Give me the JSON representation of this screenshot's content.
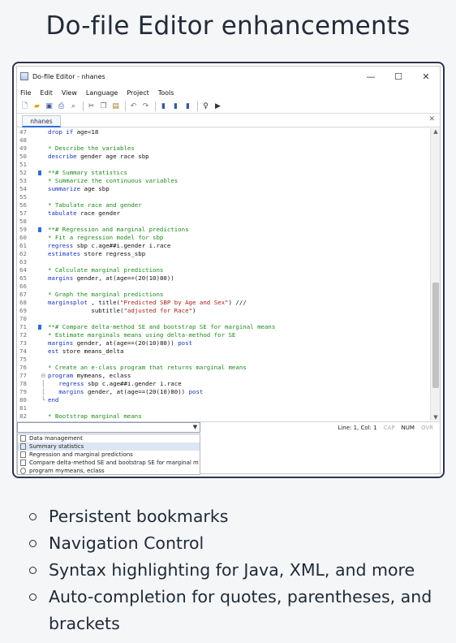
{
  "heading": "Do-file Editor enhancements",
  "window": {
    "title": "Do-file Editor - nhanes",
    "controls": [
      "—",
      "☐",
      "✕"
    ]
  },
  "menu": [
    "File",
    "Edit",
    "View",
    "Language",
    "Project",
    "Tools"
  ],
  "toolbar_icons": [
    "new-icon",
    "open-icon",
    "save-icon",
    "print-icon",
    "find-icon",
    "cut-icon",
    "copy-icon",
    "paste-icon",
    "undo-icon",
    "redo-icon",
    "bookmark-toggle-icon",
    "bookmark-next-icon",
    "bookmark-prev-icon",
    "show-icon",
    "execute-icon"
  ],
  "tab": {
    "label": "nhanes",
    "close": "✕"
  },
  "editor": {
    "lines": [
      {
        "n": "47",
        "bm": false,
        "code": [
          [
            "kw",
            "drop if"
          ],
          [
            "",
            "age<18"
          ]
        ]
      },
      {
        "n": "48",
        "bm": false,
        "code": []
      },
      {
        "n": "49",
        "bm": false,
        "code": [
          [
            "cm",
            "* Describe the variables"
          ]
        ]
      },
      {
        "n": "50",
        "bm": false,
        "code": [
          [
            "kw",
            "describe"
          ],
          [
            "",
            "gender age race sbp"
          ]
        ]
      },
      {
        "n": "51",
        "bm": false,
        "code": []
      },
      {
        "n": "52",
        "bm": true,
        "code": [
          [
            "cm",
            "**# Summary statistics"
          ]
        ]
      },
      {
        "n": "53",
        "bm": false,
        "code": [
          [
            "cm",
            "* Summarize the continuous variables"
          ]
        ]
      },
      {
        "n": "54",
        "bm": false,
        "code": [
          [
            "kw",
            "summarize"
          ],
          [
            "",
            "age sbp"
          ]
        ]
      },
      {
        "n": "55",
        "bm": false,
        "code": []
      },
      {
        "n": "56",
        "bm": false,
        "code": [
          [
            "cm",
            "* Tabulate race and gender"
          ]
        ]
      },
      {
        "n": "57",
        "bm": false,
        "code": [
          [
            "kw",
            "tabulate"
          ],
          [
            "",
            "race gender"
          ]
        ]
      },
      {
        "n": "58",
        "bm": false,
        "code": []
      },
      {
        "n": "59",
        "bm": true,
        "code": [
          [
            "cm",
            "**# Regression and marginal predictions"
          ]
        ]
      },
      {
        "n": "60",
        "bm": false,
        "code": [
          [
            "cm",
            "* Fit a regression model for sbp"
          ]
        ]
      },
      {
        "n": "61",
        "bm": false,
        "code": [
          [
            "kw",
            "regress"
          ],
          [
            "",
            "sbp c.age##i.gender i.race"
          ]
        ]
      },
      {
        "n": "62",
        "bm": false,
        "code": [
          [
            "kw",
            "estimates"
          ],
          [
            "",
            "store regress_sbp"
          ]
        ]
      },
      {
        "n": "63",
        "bm": false,
        "code": []
      },
      {
        "n": "64",
        "bm": false,
        "code": [
          [
            "cm",
            "* Calculate marginal predictions"
          ]
        ]
      },
      {
        "n": "65",
        "bm": false,
        "code": [
          [
            "kw",
            "margins"
          ],
          [
            "",
            "gender, at(age==(20(10)80))"
          ]
        ]
      },
      {
        "n": "66",
        "bm": false,
        "code": []
      },
      {
        "n": "67",
        "bm": false,
        "code": [
          [
            "cm",
            "* Graph the marginal predictions"
          ]
        ]
      },
      {
        "n": "68",
        "bm": false,
        "code": [
          [
            "kw",
            "marginsplot"
          ],
          [
            "",
            ", title("
          ],
          [
            "st",
            "\"Predicted SBP by Age and Sex\""
          ],
          [
            "",
            ") ///"
          ]
        ]
      },
      {
        "n": "69",
        "bm": false,
        "code": [
          [
            "",
            "            subtitle("
          ],
          [
            "st",
            "\"adjusted for Race\""
          ],
          [
            "",
            ")"
          ]
        ]
      },
      {
        "n": "70",
        "bm": false,
        "code": []
      },
      {
        "n": "71",
        "bm": true,
        "code": [
          [
            "cm",
            "**# Compare delta-method SE and bootstrap SE for marginal means"
          ]
        ]
      },
      {
        "n": "72",
        "bm": false,
        "code": [
          [
            "cm",
            "* Estimate marginals means using delta-method for SE"
          ]
        ]
      },
      {
        "n": "73",
        "bm": false,
        "code": [
          [
            "kw",
            "margins"
          ],
          [
            "",
            "gender, at(age==(20(10)80))"
          ],
          [
            "kw",
            "post"
          ]
        ]
      },
      {
        "n": "74",
        "bm": false,
        "code": [
          [
            "kw",
            "est"
          ],
          [
            "",
            "store means_delta"
          ]
        ]
      },
      {
        "n": "75",
        "bm": false,
        "code": []
      },
      {
        "n": "76",
        "bm": false,
        "code": [
          [
            "cm",
            "* Create an e-class program that returns marginal means"
          ]
        ]
      },
      {
        "n": "77",
        "bm": false,
        "fold": "⊟",
        "code": [
          [
            "kw",
            "program"
          ],
          [
            "",
            "mymeans, eclass"
          ]
        ]
      },
      {
        "n": "78",
        "bm": false,
        "fold": "│",
        "code": [
          [
            "",
            "  "
          ],
          [
            "kw",
            "regress"
          ],
          [
            "",
            "sbp c.age##i.gender i.race"
          ]
        ]
      },
      {
        "n": "79",
        "bm": false,
        "fold": "│",
        "code": [
          [
            "",
            "  "
          ],
          [
            "kw",
            "margins"
          ],
          [
            "",
            "gender, at(age==(20(10)80))"
          ],
          [
            "kw",
            "post"
          ]
        ]
      },
      {
        "n": "80",
        "bm": false,
        "fold": "└",
        "code": [
          [
            "kw",
            "end"
          ]
        ]
      },
      {
        "n": "81",
        "bm": false,
        "code": []
      },
      {
        "n": "82",
        "bm": false,
        "code": [
          [
            "cm",
            "* Bootstrap marginal means"
          ]
        ]
      }
    ]
  },
  "statusbar": {
    "position": "Line: 1, Col: 1",
    "cap": "CAP",
    "num": "NUM",
    "ovr": "OVR"
  },
  "navigation": {
    "items": [
      {
        "label": "Data management",
        "icon": "bookmark",
        "selected": false
      },
      {
        "label": "Summary statistics",
        "icon": "bookmark",
        "selected": true
      },
      {
        "label": "Regression and marginal predictions",
        "icon": "bookmark",
        "selected": false
      },
      {
        "label": "Compare delta-method SE and bootstrap SE for marginal m",
        "icon": "bookmark",
        "selected": false
      },
      {
        "label": "program mymeans, eclass",
        "icon": "program",
        "selected": false
      }
    ]
  },
  "features": [
    "Persistent bookmarks",
    "Navigation Control",
    "Syntax highlighting for Java, XML, and more",
    "Auto-completion for quotes, parentheses, and brackets"
  ]
}
